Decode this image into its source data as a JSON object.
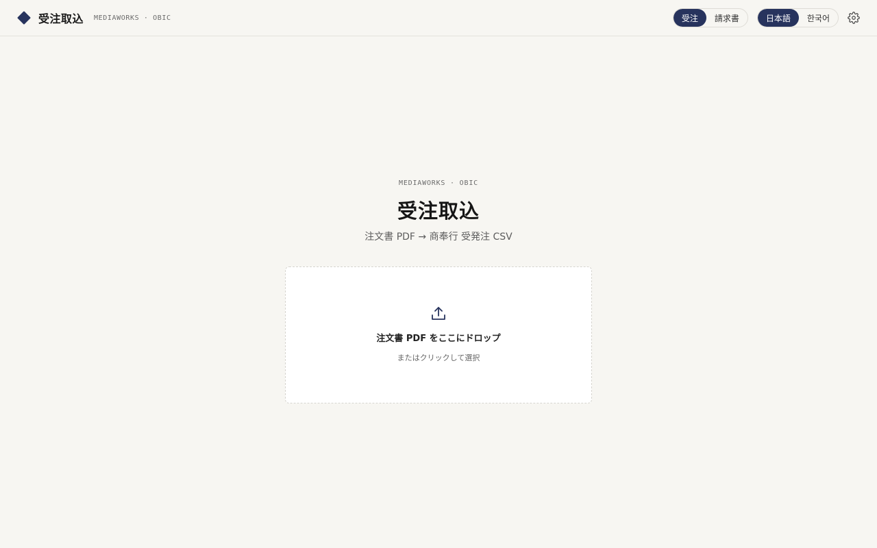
{
  "header": {
    "title": "受注取込",
    "subtitle": "MEDIAWORKS · OBIC",
    "mode_toggle": {
      "options": [
        "受注",
        "請求書"
      ],
      "selected": "受注"
    },
    "language_toggle": {
      "options": [
        "日本語",
        "한국어"
      ],
      "selected": "日本語"
    },
    "settings_icon": "gear-icon"
  },
  "hero": {
    "kicker": "MEDIAWORKS · OBIC",
    "title": "受注取込",
    "subtitle": "注文書 PDF → 商奉行 受発注 CSV"
  },
  "dropzone": {
    "icon": "upload-icon",
    "title": "注文書 PDF をここにドロップ",
    "subtitle": "またはクリックして選択"
  },
  "colors": {
    "accent": "#27335d",
    "background": "#f7f6f2",
    "surface": "#ffffff"
  }
}
